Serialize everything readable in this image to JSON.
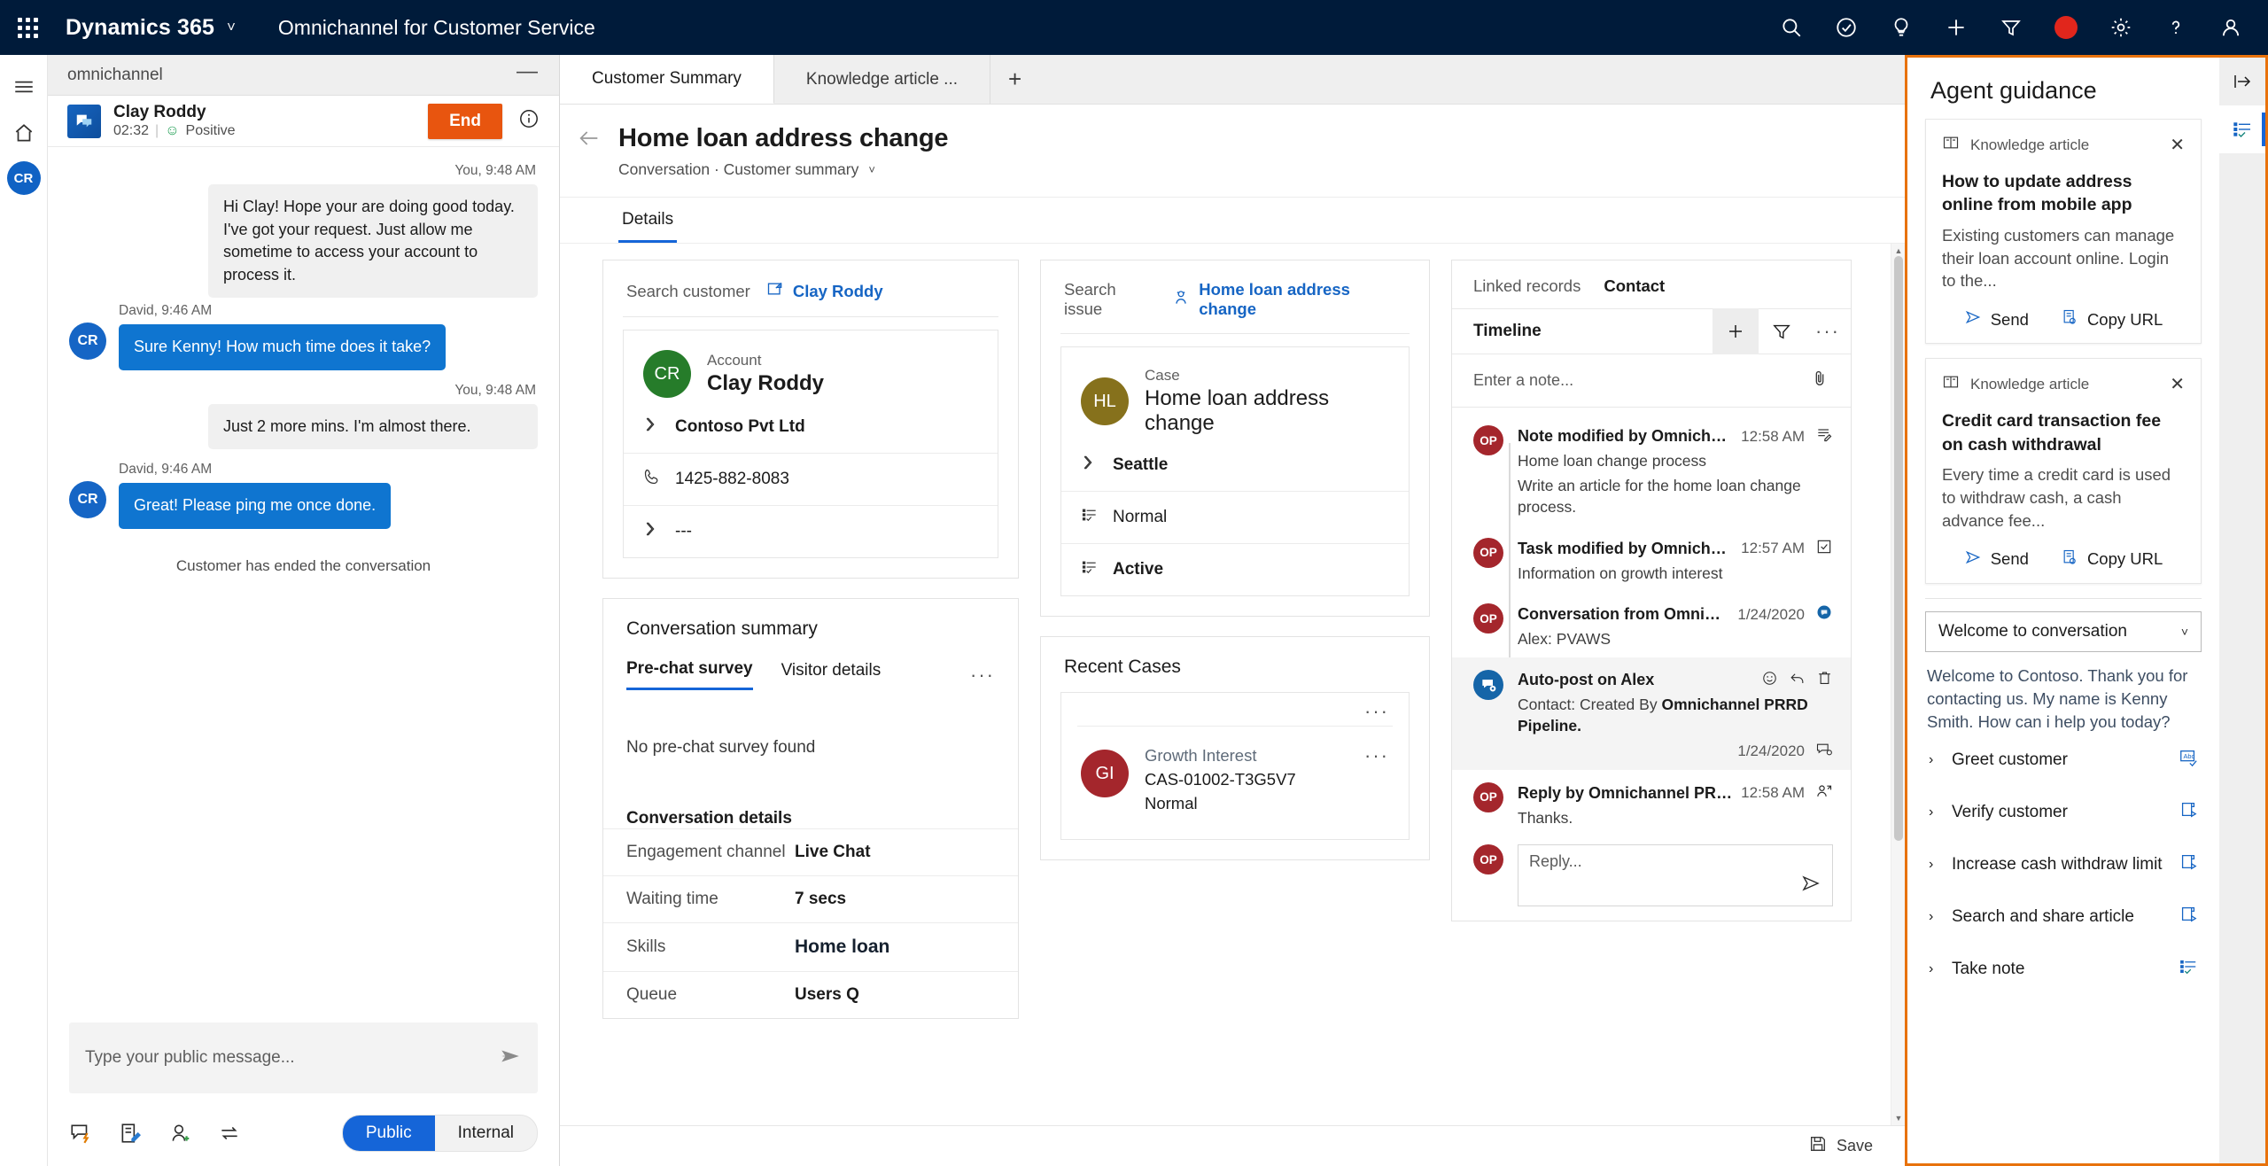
{
  "topnav": {
    "waffle": "app-launcher",
    "brand": "Dynamics 365",
    "app_name": "Omnichannel for Customer Service",
    "icons": [
      "search-icon",
      "check-circle-icon",
      "lightbulb-icon",
      "plus-icon",
      "filter-icon",
      "record-icon",
      "gear-icon",
      "help-icon",
      "account-icon"
    ]
  },
  "rail": {
    "menu": "hamburger-menu",
    "home": "home-icon",
    "avatar_initials": "CR"
  },
  "chat": {
    "window_title": "omnichannel",
    "minimize": "—",
    "customer_name": "Clay Roddy",
    "duration": "02:32",
    "sentiment": "Positive",
    "end_label": "End",
    "messages": [
      {
        "time": "You, 9:48 AM",
        "side": "agent",
        "author": "",
        "text": "Hi Clay! Hope your are doing good today. I've got your request. Just allow me sometime to access your account to process it."
      },
      {
        "time": "David, 9:46 AM",
        "side": "customer",
        "author": "CR",
        "text": "Sure Kenny! How much time does it take?"
      },
      {
        "time": "You, 9:48 AM",
        "side": "agent",
        "author": "",
        "text": "Just 2 more mins. I'm almost there."
      },
      {
        "time": "David, 9:46 AM",
        "side": "customer",
        "author": "CR",
        "text": "Great! Please ping me once done."
      }
    ],
    "ended_notice": "Customer has ended the conversation",
    "compose_placeholder": "Type your public message...",
    "toolbar_icons": [
      "quick-reply-icon",
      "note-icon",
      "consult-icon",
      "transfer-icon"
    ],
    "mode_public": "Public",
    "mode_internal": "Internal"
  },
  "main": {
    "tabs": [
      {
        "label": "Customer Summary",
        "active": true
      },
      {
        "label": "Knowledge article ...",
        "active": false
      }
    ],
    "add_tab": "+",
    "back": "back-arrow-icon",
    "page_title": "Home loan address change",
    "breadcrumb": "Conversation · Customer summary",
    "subtab": "Details",
    "customer_card": {
      "search_label": "Search customer",
      "search_link": "Clay Roddy",
      "entity_type": "Account",
      "entity_name": "Clay Roddy",
      "initials": "CR",
      "initials_color": "#267C2A",
      "rows": [
        {
          "icon": "company-icon",
          "value": "Contoso Pvt Ltd"
        },
        {
          "icon": "phone-icon",
          "value": "1425-882-8083"
        },
        {
          "icon": "company-icon",
          "value": "---"
        }
      ]
    },
    "case_card": {
      "search_label": "Search issue",
      "search_link": "Home loan address  change",
      "entity_type": "Case",
      "entity_name": "Home loan address change",
      "initials": "HL",
      "initials_color": "#86711C",
      "rows": [
        {
          "icon": "company-icon",
          "value": "Seattle"
        },
        {
          "icon": "list-icon",
          "value": "Normal"
        },
        {
          "icon": "list-icon",
          "value": "Active"
        }
      ]
    },
    "conversation_summary": {
      "title": "Conversation summary",
      "tabs": [
        "Pre-chat survey",
        "Visitor details"
      ],
      "more": "···",
      "empty_text": "No pre-chat survey found",
      "section_title": "Conversation details",
      "rows": [
        {
          "key": "Engagement channel",
          "value": "Live Chat"
        },
        {
          "key": "Waiting time",
          "value": "7 secs"
        },
        {
          "key": "Skills",
          "value": "Home loan"
        },
        {
          "key": "Queue",
          "value": "Users Q"
        }
      ]
    },
    "recent_cases": {
      "title": "Recent Cases",
      "items": [
        {
          "initials": "GI",
          "name": "Growth Interest",
          "id": "CAS-01002-T3G5V7",
          "priority": "Normal"
        }
      ]
    },
    "timeline": {
      "tab_linked": "Linked records",
      "tab_contact": "Contact",
      "title": "Timeline",
      "actions": [
        "plus-icon",
        "filter-icon",
        "more-icon"
      ],
      "note_placeholder": "Enter a note...",
      "attach": "paperclip-icon",
      "items": [
        {
          "avatar": "OP",
          "kind": "op",
          "title": "Note modified by Omnichan...",
          "sub1": "Home loan change process",
          "sub2": "Write an article for the home loan change process.",
          "time": "12:58 AM",
          "icon": "note-icon",
          "highlight": false
        },
        {
          "avatar": "OP",
          "kind": "op",
          "title": "Task modified by Omnichann...",
          "sub1": "Information on growth interest",
          "sub2": "",
          "time": "12:57 AM",
          "icon": "task-checkbox-icon",
          "highlight": false
        },
        {
          "avatar": "OP",
          "kind": "op",
          "title": "Conversation from Omnichan...",
          "sub1": "Alex: PVAWS",
          "sub2": "",
          "time": "1/24/2020",
          "icon": "conversation-badge-icon",
          "highlight": false
        },
        {
          "avatar": "",
          "kind": "post",
          "title": "Auto-post on Alex",
          "sub1": "Contact: Created By Omnichannel PRRD Pipeline.",
          "sub2": "",
          "time": "1/24/2020",
          "icon": "post-icon",
          "highlight": true
        },
        {
          "avatar": "OP",
          "kind": "op",
          "title": "Reply by Omnichannel PRRD Pipeline",
          "sub1": "Thanks.",
          "sub2": "",
          "time": "12:58 AM",
          "icon": "person-reply-icon",
          "highlight": false
        }
      ],
      "reply_avatar": "OP",
      "reply_placeholder": "Reply...",
      "reply_send": "send-icon"
    },
    "save_label": "Save",
    "save_icon": "save-icon"
  },
  "agent_guidance": {
    "title": "Agent guidance",
    "expand_icon": "expand-panel-icon",
    "rail_icon": "agent-script-icon",
    "cards": [
      {
        "kind": "Knowledge article",
        "kind_icon": "book-icon",
        "close": "close-icon",
        "title": "How to update address online from mobile app",
        "snippet": "Existing customers can manage their loan account online. Login to the...",
        "send_label": "Send",
        "copy_label": "Copy URL"
      },
      {
        "kind": "Knowledge article",
        "kind_icon": "book-icon",
        "close": "close-icon",
        "title": "Credit card transaction fee on cash withdrawal",
        "snippet": "Every time a credit card is used to withdraw cash, a cash advance fee...",
        "send_label": "Send",
        "copy_label": "Copy URL"
      }
    ],
    "select_value": "Welcome to conversation",
    "welcome_text": "Welcome to Contoso. Thank you for contacting us. My name is Kenny Smith. How can i help you today?",
    "steps": [
      {
        "label": "Greet customer",
        "icon": "abc-check-icon"
      },
      {
        "label": "Verify customer",
        "icon": "script-run-icon"
      },
      {
        "label": "Increase cash withdraw limit",
        "icon": "script-run-icon"
      },
      {
        "label": "Search and share article",
        "icon": "script-run-icon"
      },
      {
        "label": "Take note",
        "icon": "list-check-icon"
      }
    ]
  },
  "colors": {
    "nav_bg": "#001B3A",
    "accent_blue": "#1565D8",
    "end_orange": "#E8550F",
    "panel_border_orange": "#E8720C",
    "customer_bubble": "#0F75D0"
  }
}
